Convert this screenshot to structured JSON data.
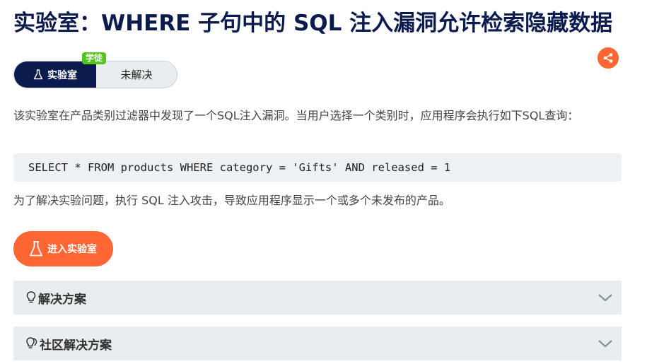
{
  "page": {
    "title": "实验室：WHERE 子句中的 SQL 注入漏洞允许检索隐藏数据",
    "level_badge": "学徒",
    "lab_tag_label": "实验室",
    "status_label": "未解决",
    "description": "该实验室在产品类别过滤器中发现了一个SQL注入漏洞。当用户选择一个类别时，应用程序会执行如下SQL查询：",
    "sql_query": "SELECT * FROM products WHERE category = 'Gifts' AND released = 1",
    "goal": "为了解决实验问题，执行 SQL 注入攻击，导致应用程序显示一个或多个未发布的产品。",
    "access_button_label": "进入实验室"
  },
  "accordions": [
    {
      "label": "解决方案",
      "icon": "lightbulb-icon"
    },
    {
      "label": "社区解决方案",
      "icon": "community-lightbulb-icon"
    }
  ],
  "colors": {
    "title": "#0c1b4d",
    "accent": "#ff6633",
    "badge": "#52c41a",
    "accordion_bg": "#e8eef0"
  }
}
